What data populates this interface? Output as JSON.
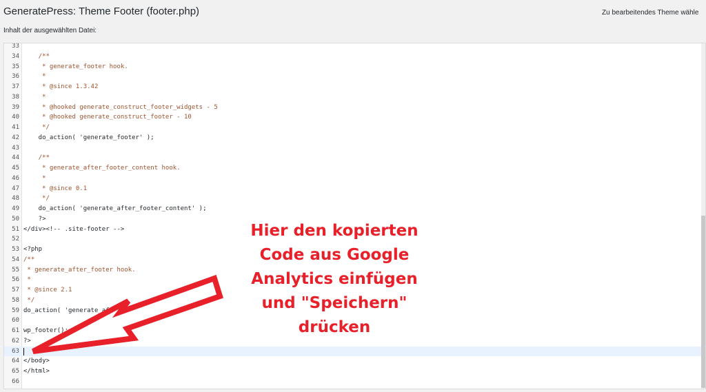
{
  "header": {
    "title": "GeneratePress: Theme Footer (footer.php)",
    "theme_select_label": "Zu bearbeitendes Theme wähle"
  },
  "editor": {
    "file_label": "Inhalt der ausgewählten Datei:",
    "active_line": 63,
    "lines": [
      {
        "n": "33",
        "code": ""
      },
      {
        "n": "34",
        "code": "    /**"
      },
      {
        "n": "35",
        "code": "     * generate_footer hook."
      },
      {
        "n": "36",
        "code": "     *"
      },
      {
        "n": "37",
        "code": "     * @since 1.3.42"
      },
      {
        "n": "38",
        "code": "     *"
      },
      {
        "n": "39",
        "code": "     * @hooked generate_construct_footer_widgets - 5"
      },
      {
        "n": "40",
        "code": "     * @hooked generate_construct_footer - 10"
      },
      {
        "n": "41",
        "code": "     */"
      },
      {
        "n": "42",
        "code": "    do_action( 'generate_footer' );"
      },
      {
        "n": "43",
        "code": ""
      },
      {
        "n": "44",
        "code": "    /**"
      },
      {
        "n": "45",
        "code": "     * generate_after_footer_content hook."
      },
      {
        "n": "46",
        "code": "     *"
      },
      {
        "n": "47",
        "code": "     * @since 0.1"
      },
      {
        "n": "48",
        "code": "     */"
      },
      {
        "n": "49",
        "code": "    do_action( 'generate_after_footer_content' );"
      },
      {
        "n": "50",
        "code": "    ?>"
      },
      {
        "n": "51",
        "code": "</div><!-- .site-footer -->"
      },
      {
        "n": "52",
        "code": ""
      },
      {
        "n": "53",
        "code": "<?php"
      },
      {
        "n": "54",
        "code": "/**"
      },
      {
        "n": "55",
        "code": " * generate_after_footer hook."
      },
      {
        "n": "56",
        "code": " *"
      },
      {
        "n": "57",
        "code": " * @since 2.1"
      },
      {
        "n": "58",
        "code": " */"
      },
      {
        "n": "59",
        "code": "do_action( 'generate_after_footer' );"
      },
      {
        "n": "60",
        "code": ""
      },
      {
        "n": "61",
        "code": "wp_footer();"
      },
      {
        "n": "62",
        "code": "?>"
      },
      {
        "n": "63",
        "code": ""
      },
      {
        "n": "64",
        "code": "</body>"
      },
      {
        "n": "65",
        "code": "</html>"
      },
      {
        "n": "66",
        "code": ""
      }
    ]
  },
  "annotation": {
    "line1": "Hier den kopierten",
    "line2": "Code aus Google",
    "line3": "Analytics einfügen",
    "line4": "und \"Speichern\"",
    "line5": "drücken",
    "color": "#e8202a"
  }
}
